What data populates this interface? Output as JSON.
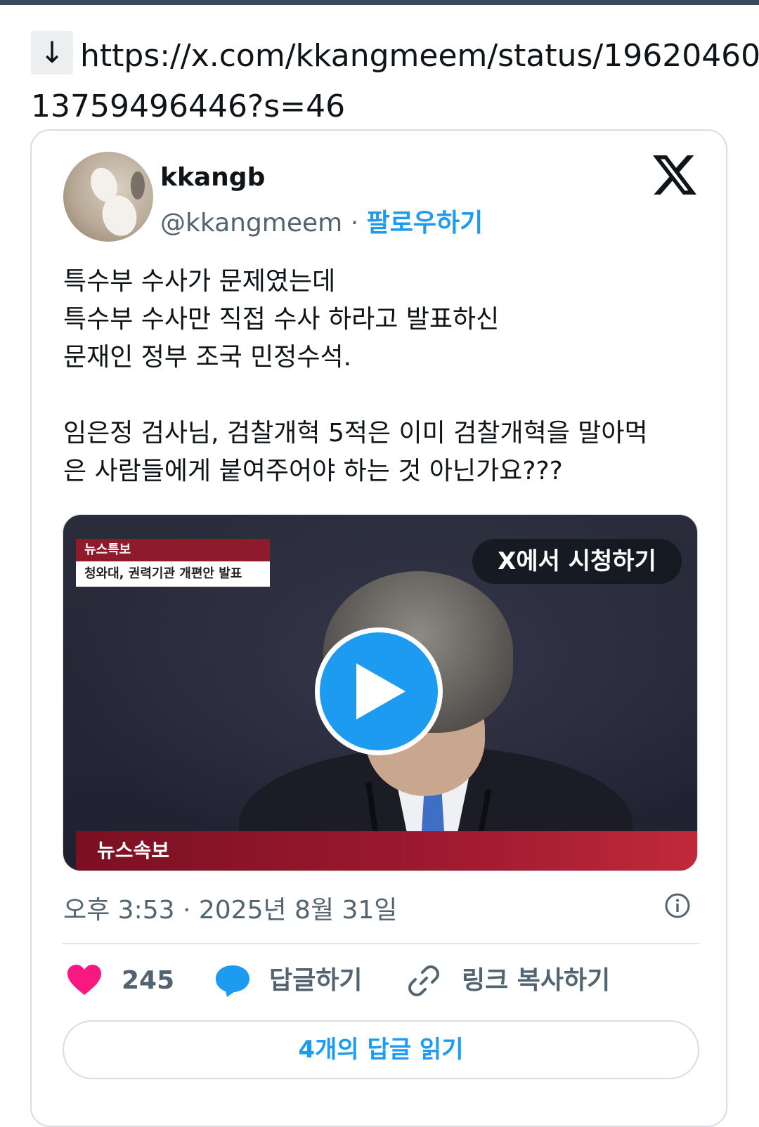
{
  "url": {
    "arrow_icon": "↓",
    "line1": "https://x.com/kkangmeem/status/19620460",
    "line2": "13759496446?s=46"
  },
  "tweet": {
    "author_name": "kkangb",
    "handle": "@kkangmeem",
    "separator": "·",
    "follow_label": "팔로우하기",
    "text_lines": [
      "특수부 수사가 문제였는데",
      "특수부 수사만 직접 수사 하라고 발표하신",
      "문재인 정부 조국 민정수석.",
      "",
      "임은정 검사님, 검찰개혁 5적은 이미 검찰개혁을 말아먹",
      "은 사람들에게 붙여주어야 하는 것 아닌가요???"
    ],
    "video": {
      "badge_top_label": "뉴스특보",
      "badge_top_caption": "청와대, 권력기관 개편안 발표",
      "watch_label": "X에서 시청하기",
      "bottom_label": "뉴스속보"
    },
    "timestamp": "오후 3:53 · 2025년 8월 31일",
    "likes_count": "245",
    "reply_label": "답글하기",
    "copy_link_label": "링크 복사하기",
    "read_replies_label": "4개의 답글 읽기"
  },
  "colors": {
    "accent": "#1d9bf0",
    "like": "#f91880",
    "muted": "#536471"
  }
}
